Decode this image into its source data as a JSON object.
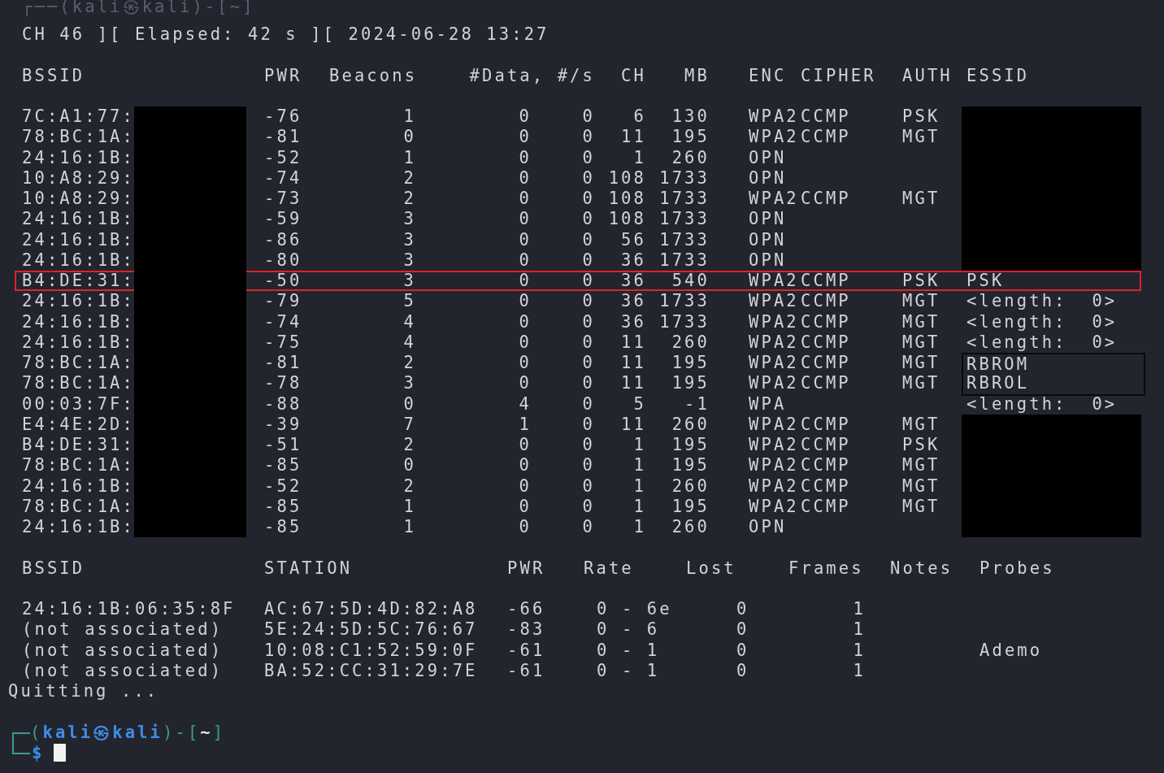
{
  "faded_prompt": "┌──(kali㉿kali)-[~]",
  "status_line": "CH 46 ][ Elapsed: 42 s ][ 2024-06-28 13:27",
  "ap_table": {
    "columns": [
      "BSSID",
      "PWR",
      "Beacons",
      "#Data, #/s",
      "CH",
      "MB",
      "ENC",
      "CIPHER",
      "AUTH",
      "ESSID"
    ],
    "rows": [
      {
        "bssid": "7C:A1:77:",
        "bssid_redacted": true,
        "pwr": "-76",
        "beacons": "1",
        "data": "0",
        "per_s": "0",
        "ch": "6",
        "mb": "130",
        "enc": "WPA2",
        "cipher": "CCMP",
        "auth": "PSK",
        "essid_redacted": true,
        "selected": false
      },
      {
        "bssid": "78:BC:1A:",
        "bssid_redacted": true,
        "pwr": "-81",
        "beacons": "0",
        "data": "0",
        "per_s": "0",
        "ch": "11",
        "mb": "195",
        "enc": "WPA2",
        "cipher": "CCMP",
        "auth": "MGT",
        "essid_redacted": true,
        "selected": false
      },
      {
        "bssid": "24:16:1B:",
        "bssid_redacted": true,
        "pwr": "-52",
        "beacons": "1",
        "data": "0",
        "per_s": "0",
        "ch": "1",
        "mb": "260",
        "enc": "OPN",
        "essid_redacted": true,
        "selected": false
      },
      {
        "bssid": "10:A8:29:",
        "bssid_redacted": true,
        "pwr": "-74",
        "beacons": "2",
        "data": "0",
        "per_s": "0",
        "ch": "108",
        "mb": "1733",
        "enc": "OPN",
        "essid_redacted": true,
        "selected": false
      },
      {
        "bssid": "10:A8:29:",
        "bssid_redacted": true,
        "pwr": "-73",
        "beacons": "2",
        "data": "0",
        "per_s": "0",
        "ch": "108",
        "mb": "1733",
        "enc": "WPA2",
        "cipher": "CCMP",
        "auth": "MGT",
        "essid_redacted": true,
        "selected": false
      },
      {
        "bssid": "24:16:1B:",
        "bssid_redacted": true,
        "pwr": "-59",
        "beacons": "3",
        "data": "0",
        "per_s": "0",
        "ch": "108",
        "mb": "1733",
        "enc": "OPN",
        "essid_redacted": true,
        "selected": false
      },
      {
        "bssid": "24:16:1B:",
        "bssid_redacted": true,
        "pwr": "-86",
        "beacons": "3",
        "data": "0",
        "per_s": "0",
        "ch": "56",
        "mb": "1733",
        "enc": "OPN",
        "essid_redacted": true,
        "selected": false
      },
      {
        "bssid": "24:16:1B:",
        "bssid_redacted": true,
        "pwr": "-80",
        "beacons": "3",
        "data": "0",
        "per_s": "0",
        "ch": "36",
        "mb": "1733",
        "enc": "OPN",
        "essid_redacted": true,
        "selected": false
      },
      {
        "bssid": "B4:DE:31:",
        "bssid_redacted": true,
        "pwr": "-50",
        "beacons": "3",
        "data": "0",
        "per_s": "0",
        "ch": "36",
        "mb": "540",
        "enc": "WPA2",
        "cipher": "CCMP",
        "auth": "PSK",
        "essid": "PSK",
        "selected": true
      },
      {
        "bssid": "24:16:1B:",
        "bssid_redacted": true,
        "pwr": "-79",
        "beacons": "5",
        "data": "0",
        "per_s": "0",
        "ch": "36",
        "mb": "1733",
        "enc": "WPA2",
        "cipher": "CCMP",
        "auth": "MGT",
        "essid": "<length:  0>",
        "selected": false
      },
      {
        "bssid": "24:16:1B:",
        "bssid_redacted": true,
        "pwr": "-74",
        "beacons": "4",
        "data": "0",
        "per_s": "0",
        "ch": "36",
        "mb": "1733",
        "enc": "WPA2",
        "cipher": "CCMP",
        "auth": "MGT",
        "essid": "<length:  0>",
        "selected": false
      },
      {
        "bssid": "24:16:1B:",
        "bssid_redacted": true,
        "pwr": "-75",
        "beacons": "4",
        "data": "0",
        "per_s": "0",
        "ch": "11",
        "mb": "260",
        "enc": "WPA2",
        "cipher": "CCMP",
        "auth": "MGT",
        "essid": "<length:  0>",
        "selected": false
      },
      {
        "bssid": "78:BC:1A:",
        "bssid_redacted": true,
        "pwr": "-81",
        "beacons": "2",
        "data": "0",
        "per_s": "0",
        "ch": "11",
        "mb": "195",
        "enc": "WPA2",
        "cipher": "CCMP",
        "auth": "MGT",
        "essid": "RBROM",
        "essid_outlined": true,
        "selected": false
      },
      {
        "bssid": "78:BC:1A:",
        "bssid_redacted": true,
        "pwr": "-78",
        "beacons": "3",
        "data": "0",
        "per_s": "0",
        "ch": "11",
        "mb": "195",
        "enc": "WPA2",
        "cipher": "CCMP",
        "auth": "MGT",
        "essid": "RBROL",
        "essid_outlined": true,
        "selected": false
      },
      {
        "bssid": "00:03:7F:",
        "bssid_redacted": true,
        "pwr": "-88",
        "beacons": "0",
        "data": "4",
        "per_s": "0",
        "ch": "5",
        "mb": "-1",
        "enc": "WPA",
        "essid": "<length:  0>",
        "selected": false
      },
      {
        "bssid": "E4:4E:2D:",
        "bssid_redacted": true,
        "pwr": "-39",
        "beacons": "7",
        "data": "1",
        "per_s": "0",
        "ch": "11",
        "mb": "260",
        "enc": "WPA2",
        "cipher": "CCMP",
        "auth": "MGT",
        "essid_redacted": true,
        "selected": false
      },
      {
        "bssid": "B4:DE:31:",
        "bssid_redacted": true,
        "pwr": "-51",
        "beacons": "2",
        "data": "0",
        "per_s": "0",
        "ch": "1",
        "mb": "195",
        "enc": "WPA2",
        "cipher": "CCMP",
        "auth": "PSK",
        "essid_redacted": true,
        "selected": false
      },
      {
        "bssid": "78:BC:1A:",
        "bssid_redacted": true,
        "pwr": "-85",
        "beacons": "0",
        "data": "0",
        "per_s": "0",
        "ch": "1",
        "mb": "195",
        "enc": "WPA2",
        "cipher": "CCMP",
        "auth": "MGT",
        "essid_redacted": true,
        "selected": false
      },
      {
        "bssid": "24:16:1B:",
        "bssid_redacted": true,
        "pwr": "-52",
        "beacons": "2",
        "data": "0",
        "per_s": "0",
        "ch": "1",
        "mb": "260",
        "enc": "WPA2",
        "cipher": "CCMP",
        "auth": "MGT",
        "essid_redacted": true,
        "selected": false
      },
      {
        "bssid": "78:BC:1A:",
        "bssid_redacted": true,
        "pwr": "-85",
        "beacons": "1",
        "data": "0",
        "per_s": "0",
        "ch": "1",
        "mb": "195",
        "enc": "WPA2",
        "cipher": "CCMP",
        "auth": "MGT",
        "essid_redacted": true,
        "selected": false
      },
      {
        "bssid": "24:16:1B:",
        "bssid_redacted": true,
        "pwr": "-85",
        "beacons": "1",
        "data": "0",
        "per_s": "0",
        "ch": "1",
        "mb": "260",
        "enc": "OPN",
        "essid_redacted": true,
        "selected": false
      }
    ]
  },
  "station_table": {
    "columns": [
      "BSSID",
      "STATION",
      "PWR",
      "Rate",
      "Lost",
      "Frames",
      "Notes",
      "Probes"
    ],
    "rows": [
      {
        "bssid": "24:16:1B:06:35:8F",
        "station": "AC:67:5D:4D:82:A8",
        "pwr": "-66",
        "rate": "0 - 6e",
        "lost": "0",
        "frames": "1"
      },
      {
        "bssid": "(not associated)",
        "station": "5E:24:5D:5C:76:67",
        "pwr": "-83",
        "rate": "0 - 6",
        "lost": "0",
        "frames": "1"
      },
      {
        "bssid": "(not associated)",
        "station": "10:08:C1:52:59:0F",
        "pwr": "-61",
        "rate": "0 - 1",
        "lost": "0",
        "frames": "1",
        "probes": "Ademo"
      },
      {
        "bssid": "(not associated)",
        "station": "BA:52:CC:31:29:7E",
        "pwr": "-61",
        "rate": "0 - 1",
        "lost": "0",
        "frames": "1"
      }
    ]
  },
  "quit_message": "Quitting ...",
  "prompt": {
    "open": "(",
    "user": "kali",
    "symbol": "㉿",
    "host": "kali",
    "mid": ")-[",
    "path": "~",
    "close": "]",
    "sign": "$"
  }
}
